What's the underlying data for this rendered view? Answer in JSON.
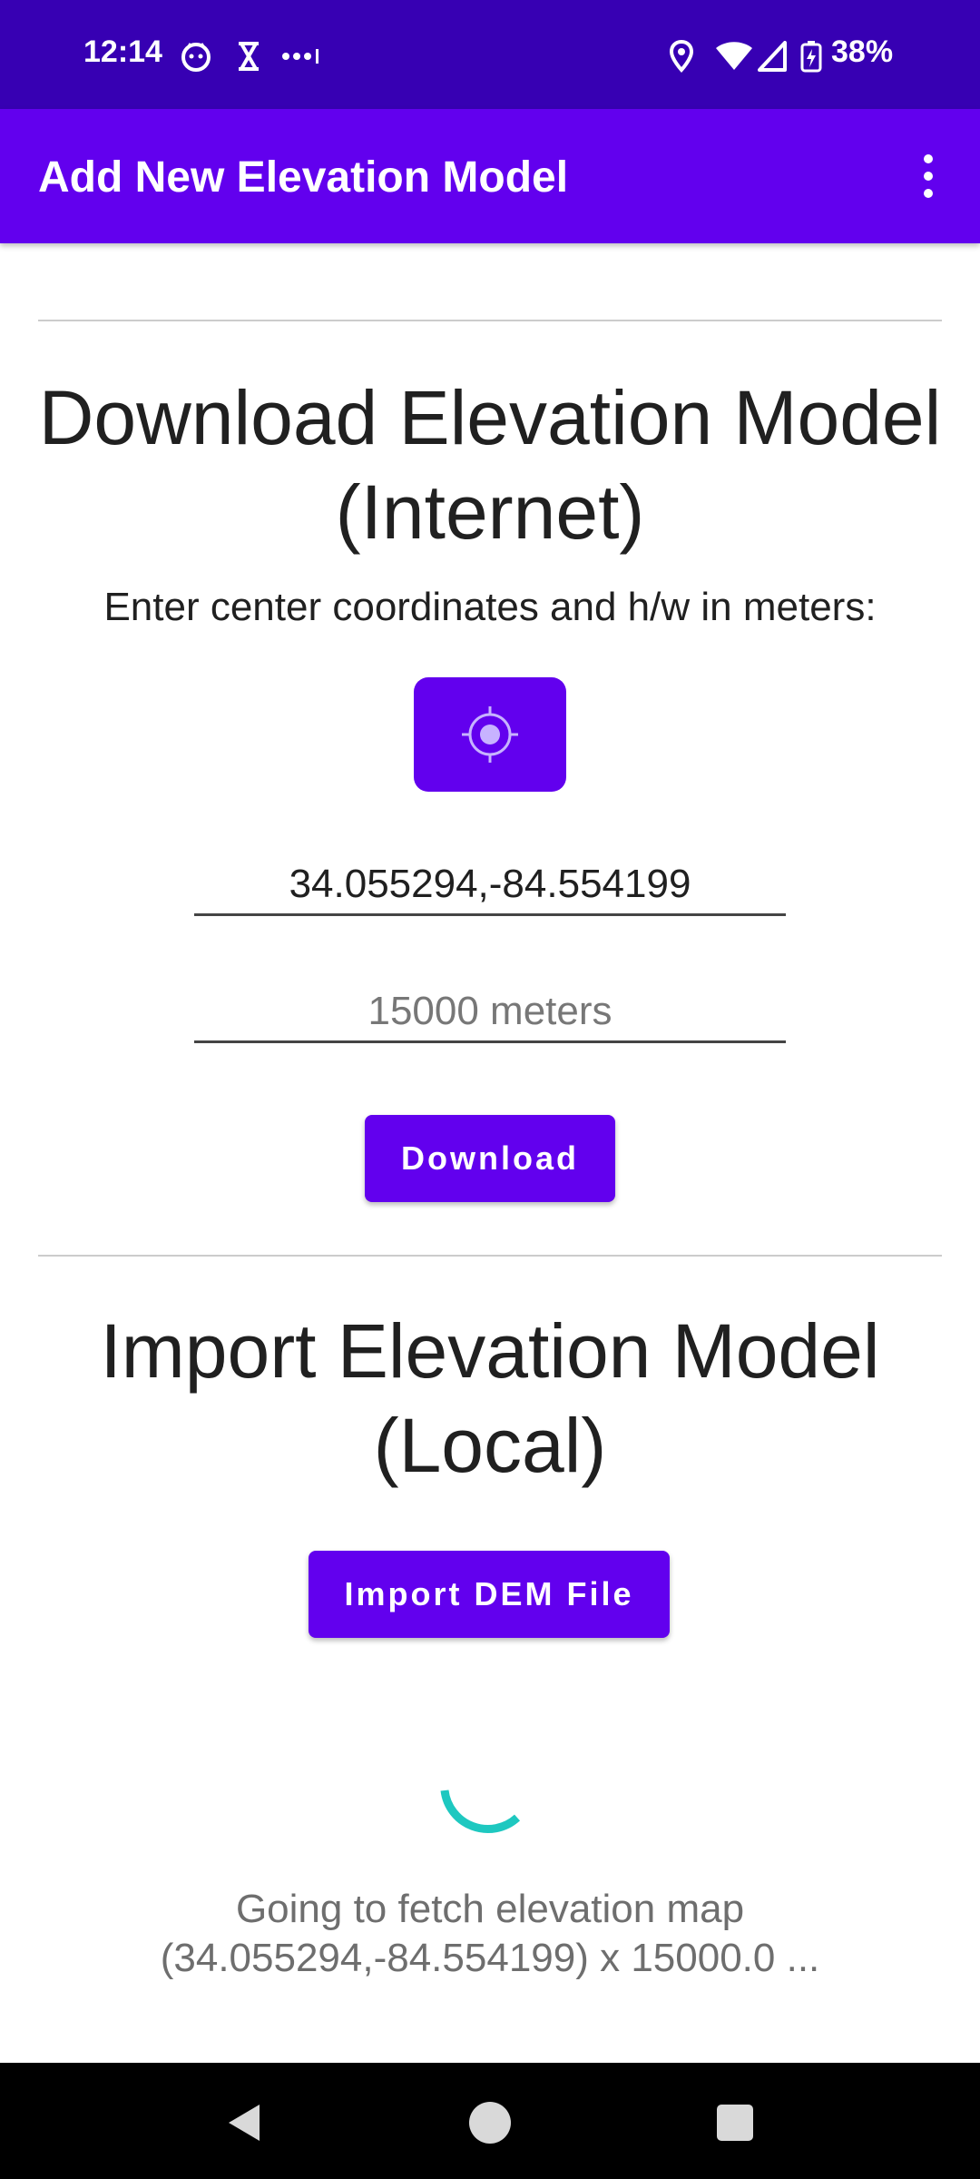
{
  "status_bar": {
    "time": "12:14",
    "battery": "38%",
    "icons": [
      "app-notification-icon",
      "hourglass-icon",
      "more-dots-icon",
      "location-icon",
      "wifi-icon",
      "signal-icon",
      "battery-charging-icon"
    ]
  },
  "app_bar": {
    "title": "Add New Elevation Model",
    "menu_icon": "overflow-menu-icon"
  },
  "download_section": {
    "title": "Download Elevation Model (Internet)",
    "subtitle": "Enter center coordinates and h/w in meters:",
    "locate_icon": "my-location-icon",
    "coordinates_value": "34.055294,-84.554199",
    "size_placeholder": "15000 meters",
    "download_label": "Download"
  },
  "import_section": {
    "title": "Import Elevation Model (Local)",
    "import_label": "Import DEM File"
  },
  "progress": {
    "message": "Going to fetch elevation map (34.055294,-84.554199) x 15000.0 ..."
  },
  "nav_bar": {
    "icons": [
      "back-icon",
      "home-icon",
      "recents-icon"
    ]
  },
  "colors": {
    "status_bar": "#3700b3",
    "primary": "#6200ee",
    "spinner": "#1ec8c0"
  }
}
